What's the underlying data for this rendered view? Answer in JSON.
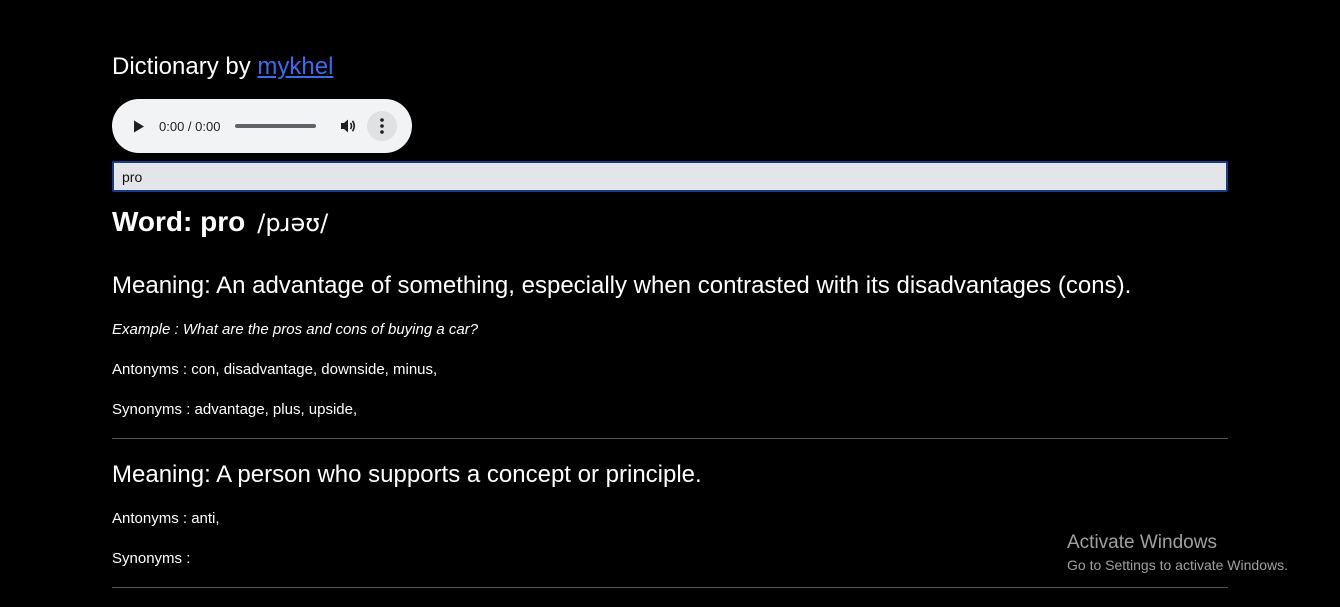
{
  "header": {
    "title_prefix": "Dictionary by ",
    "author_link": "mykhel",
    "link_color": "#3b6cf0"
  },
  "audio": {
    "time": "0:00 / 0:00",
    "play_icon": "play-icon",
    "volume_icon": "volume-icon",
    "more_icon": "more-vert-icon"
  },
  "search": {
    "value": "pro"
  },
  "word": {
    "label": "Word: pro",
    "phonetic": "/pɹəʊ/"
  },
  "meanings": [
    {
      "meaning": "Meaning: An advantage of something, especially when contrasted with its disadvantages (cons).",
      "example": "Example : What are the pros and cons of buying a car?",
      "antonyms": "Antonyms : con, disadvantage, downside, minus,",
      "synonyms": "Synonyms : advantage, plus, upside,"
    },
    {
      "meaning": "Meaning: A person who supports a concept or principle.",
      "antonyms": "Antonyms : anti,",
      "synonyms": "Synonyms :"
    }
  ],
  "watermark": {
    "title": "Activate Windows",
    "subtitle": "Go to Settings to activate Windows."
  }
}
